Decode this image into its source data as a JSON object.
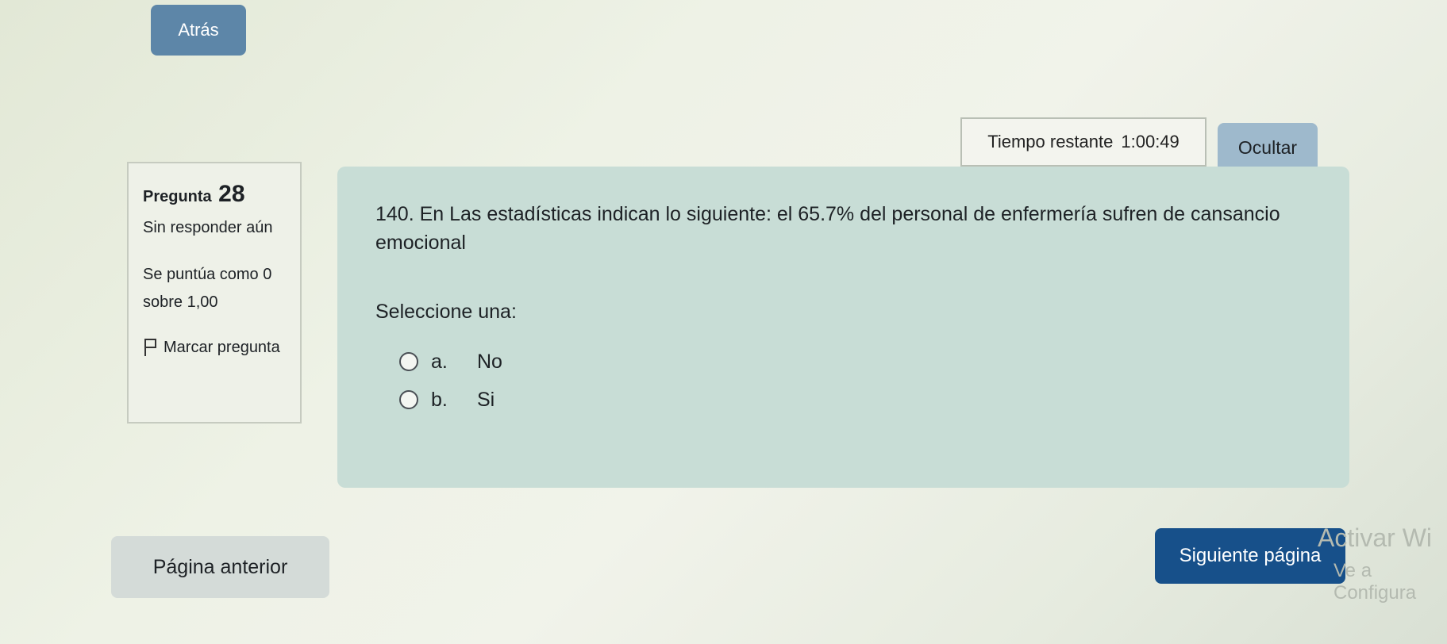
{
  "nav": {
    "back_label": "Atrás"
  },
  "timer": {
    "label": "Tiempo restante",
    "value": "1:00:49",
    "hide_label": "Ocultar"
  },
  "info": {
    "question_label": "Pregunta",
    "question_number": "28",
    "status": "Sin responder aún",
    "grade": "Se puntúa como 0 sobre 1,00",
    "flag_label": "Marcar pregunta"
  },
  "question": {
    "text": "140. En Las estadísticas indican lo siguiente: el 65.7% del personal de enfermería sufren de cansancio emocional",
    "prompt": "Seleccione una:",
    "options": [
      {
        "letter": "a.",
        "label": "No"
      },
      {
        "letter": "b.",
        "label": "Si"
      }
    ]
  },
  "footer": {
    "prev_label": "Página anterior",
    "next_label": "Siguiente página"
  },
  "watermark": {
    "line1": "Activar Wi",
    "line2": "Ve a Configura"
  }
}
